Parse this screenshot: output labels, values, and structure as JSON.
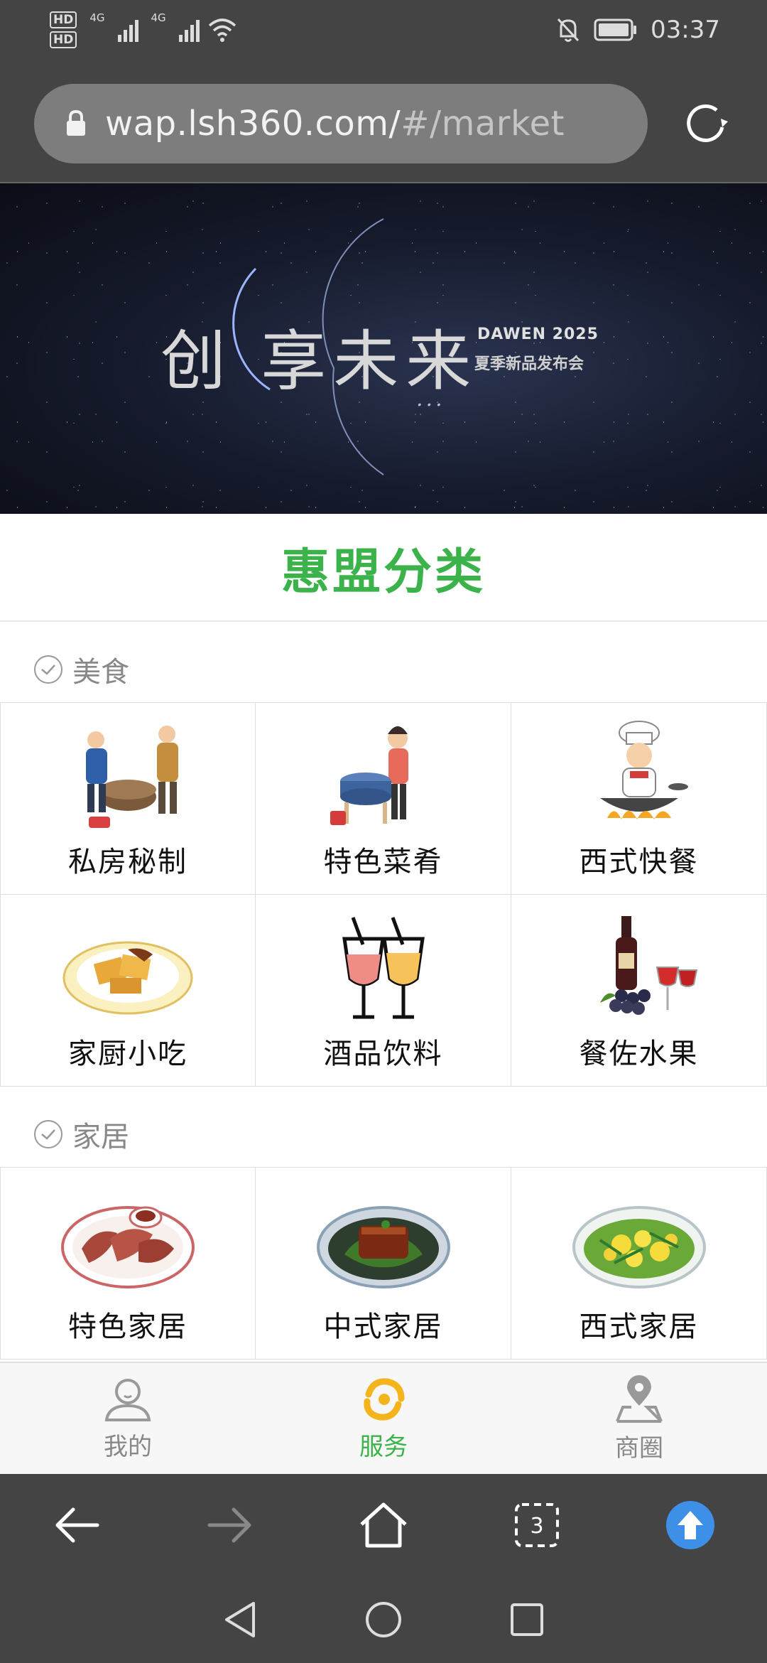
{
  "status_bar": {
    "hd1": "HD",
    "hd2": "HD",
    "net1": "4G",
    "net2": "4G",
    "time": "03:37"
  },
  "address_bar": {
    "url_main": "wap.lsh360.com/",
    "url_path": "#/market"
  },
  "banner": {
    "title": "创 享未来",
    "brand": "DAWEN 2025",
    "subtitle": "夏季新品发布会",
    "script": "..."
  },
  "page": {
    "heading": "惠盟分类"
  },
  "categories": [
    {
      "name": "美食",
      "items": [
        {
          "label": "私房秘制",
          "icon": "cooks-icon"
        },
        {
          "label": "特色菜肴",
          "icon": "grinding-icon"
        },
        {
          "label": "西式快餐",
          "icon": "chef-icon"
        },
        {
          "label": "家厨小吃",
          "icon": "snack-plate-icon"
        },
        {
          "label": "酒品饮料",
          "icon": "drinks-icon"
        },
        {
          "label": "餐佐水果",
          "icon": "wine-grapes-icon"
        }
      ]
    },
    {
      "name": "家居",
      "items": [
        {
          "label": "特色家居",
          "icon": "meat-plate-icon"
        },
        {
          "label": "中式家居",
          "icon": "braised-pork-icon"
        },
        {
          "label": "西式家居",
          "icon": "egg-dish-icon"
        }
      ]
    }
  ],
  "tabbar": {
    "tabs": [
      {
        "label": "我的",
        "icon": "user-icon"
      },
      {
        "label": "服务",
        "icon": "service-swirl-icon"
      },
      {
        "label": "商圈",
        "icon": "map-pin-icon"
      }
    ],
    "active": 1
  },
  "browser_nav": {
    "tab_count": "3"
  },
  "colors": {
    "accent_green": "#3cb34a",
    "chrome_dark": "#444444",
    "upload_blue": "#3d8fe8",
    "swirl_yellow": "#f3b41c"
  }
}
